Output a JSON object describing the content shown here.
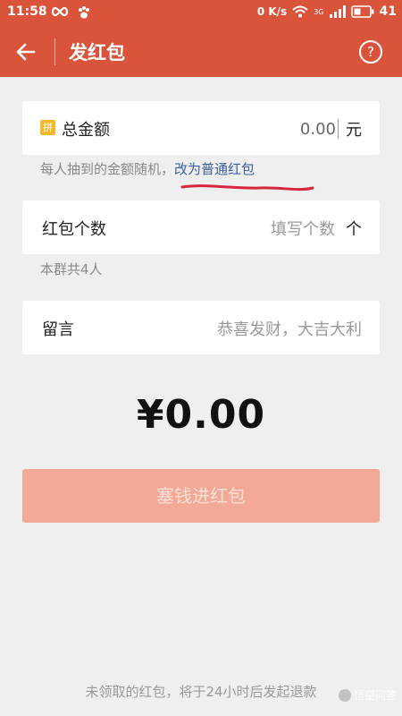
{
  "status_bar": {
    "time": "11:58",
    "speed": "0 K/s",
    "network": "3G",
    "battery": "41"
  },
  "app_bar": {
    "title": "发红包",
    "help_label": "?"
  },
  "total_amount_card": {
    "pin_badge": "拼",
    "label": "总金额",
    "value": "0.00",
    "unit": "元"
  },
  "random_hint": {
    "text": "每人抽到的金额随机，",
    "link": "改为普通红包"
  },
  "count_card": {
    "label": "红包个数",
    "placeholder": "填写个数",
    "unit": "个"
  },
  "group_hint": "本群共4人",
  "message_card": {
    "label": "留言",
    "placeholder": "恭喜发财，大吉大利"
  },
  "total_display": "¥0.00",
  "submit_button": "塞钱进红包",
  "footer_note": "未领取的红包，将于24小时后发起退款",
  "watermark": "悟空问答",
  "colors": {
    "brand_red": "#d9543a",
    "button_disabled": "#f3a996",
    "link_blue": "#3a5f9e",
    "annotation_red": "#d6263c"
  }
}
